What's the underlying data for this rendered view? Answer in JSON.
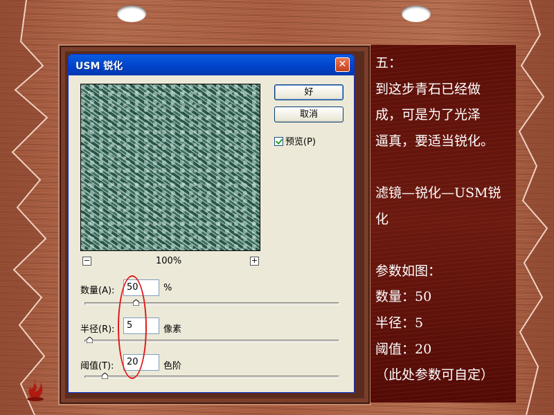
{
  "dialog": {
    "title": "USM 锐化",
    "close_glyph": "✕",
    "ok_label": "好",
    "cancel_label": "取消",
    "preview_label": "预览(P)",
    "preview_checked": true,
    "zoom_out_glyph": "−",
    "zoom_in_glyph": "+",
    "zoom_level": "100%",
    "params": [
      {
        "label": "数量(A):",
        "value": "50",
        "unit": "%",
        "slider_fraction": 0.2
      },
      {
        "label": "半径(R):",
        "value": "5",
        "unit": "像素",
        "slider_fraction": 0.02
      },
      {
        "label": "阈值(T):",
        "value": "20",
        "unit": "色阶",
        "slider_fraction": 0.08
      }
    ],
    "annotation_color": "#e01818"
  },
  "instructions": {
    "lines": [
      "五：",
      "到这步青石已经做",
      "成，可是为了光泽",
      "逼真，要适当锐化。",
      "",
      "滤镜—锐化—USM锐",
      "化",
      "",
      "参数如图：",
      "数量：50",
      "半径：5",
      "阈值：20",
      "（此处参数可自定）"
    ]
  },
  "colors": {
    "title_bar": "#0a5ce0",
    "panel_bg": "#5a0e08",
    "wood": "#a85e44"
  }
}
